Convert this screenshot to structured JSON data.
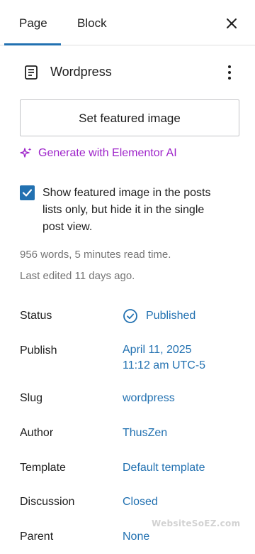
{
  "tabs": {
    "page_label": "Page",
    "block_label": "Block"
  },
  "document": {
    "title": "Wordpress"
  },
  "featured_image": {
    "button_label": "Set featured image"
  },
  "elementor": {
    "label": "Generate with Elementor AI"
  },
  "featured_option": {
    "label": "Show featured image in the posts lists only, but hide it in the single post view.",
    "checked": true
  },
  "meta": {
    "words": "956 words, 5 minutes read time.",
    "edited": "Last edited 11 days ago."
  },
  "properties": {
    "status": {
      "label": "Status",
      "value": "Published"
    },
    "publish": {
      "label": "Publish",
      "value_line1": "April 11, 2025",
      "value_line2": "11:12 am UTC-5"
    },
    "slug": {
      "label": "Slug",
      "value": "wordpress"
    },
    "author": {
      "label": "Author",
      "value": "ThusZen"
    },
    "template": {
      "label": "Template",
      "value": "Default template"
    },
    "discussion": {
      "label": "Discussion",
      "value": "Closed"
    },
    "parent": {
      "label": "Parent",
      "value": "None"
    }
  },
  "watermark": "WebsiteSoEZ.com",
  "colors": {
    "accent": "#2271b1",
    "ai_purple": "#9d22c9",
    "muted": "#757575"
  }
}
